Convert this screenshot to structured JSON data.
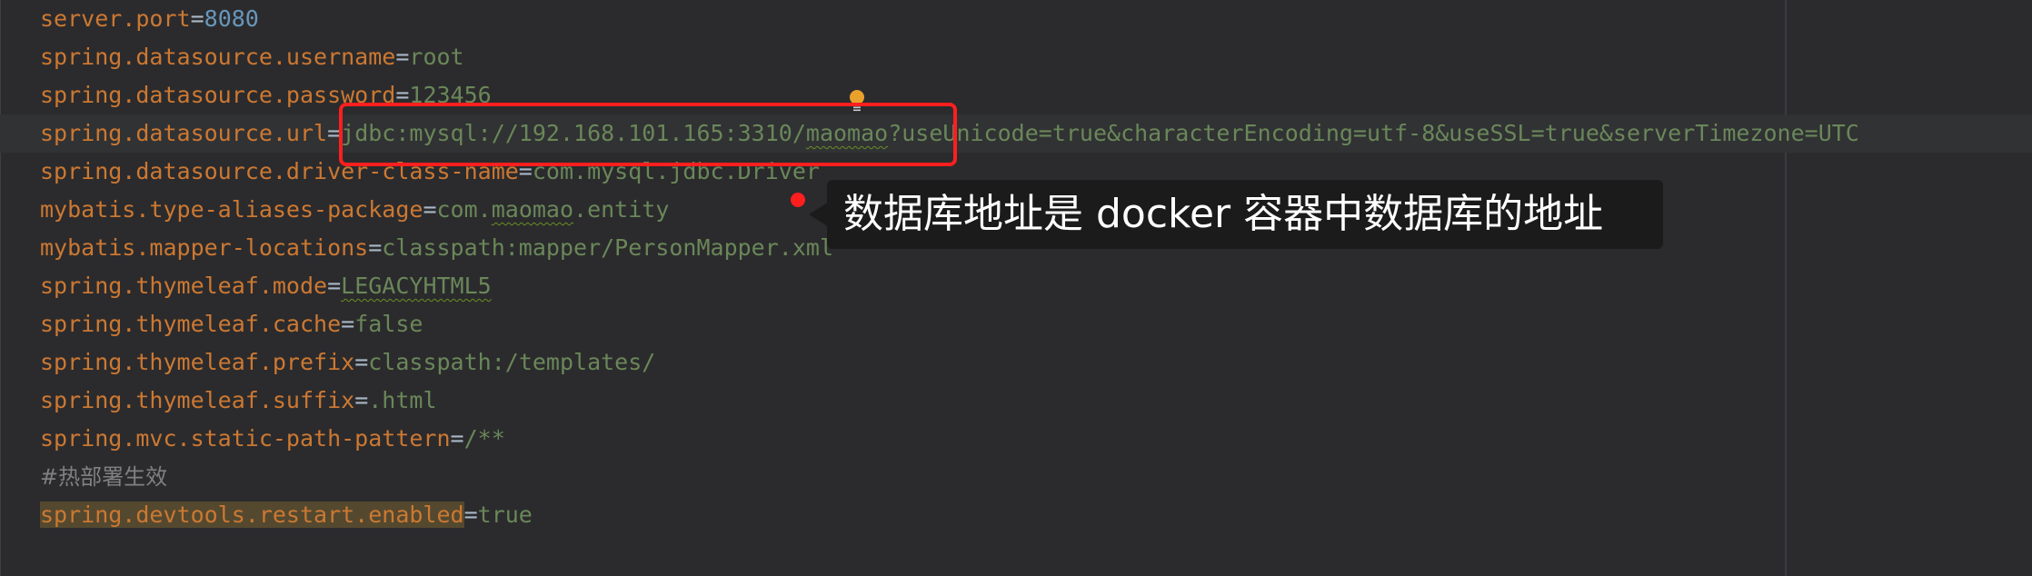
{
  "editor": {
    "lines": [
      {
        "key": "server.port",
        "eq": "=",
        "value": "8080",
        "value_kind": "number"
      },
      {
        "key": "spring.datasource.username",
        "eq": "=",
        "value": "root"
      },
      {
        "key": "spring.datasource.password",
        "eq": "=",
        "value": "123456"
      },
      {
        "key": "spring.datasource.url",
        "eq": "=",
        "value_a": "jdbc:mysql://192.168.101.165:3310/",
        "value_b": "maomao",
        "value_c": "?useUnicode=true&characterEncoding=utf-8&useSSL=true&serverTimezone=UTC"
      },
      {
        "key": "spring.datasource.driver-class-name",
        "eq": "=",
        "value": "com.mysql.jdbc.Driver"
      },
      {
        "key": "mybatis.type-aliases-package",
        "eq": "=",
        "value_a": "com.",
        "value_b": "maomao",
        "value_c": ".entity"
      },
      {
        "key": "mybatis.mapper-locations",
        "eq": "=",
        "value": "classpath:mapper/PersonMapper.xml"
      },
      {
        "key": "spring.thymeleaf.mode",
        "eq": "=",
        "value": "LEGACYHTML5"
      },
      {
        "key": "spring.thymeleaf.cache",
        "eq": "=",
        "value": "false"
      },
      {
        "key": "spring.thymeleaf.prefix",
        "eq": "=",
        "value": "classpath:/templates/"
      },
      {
        "key": "spring.thymeleaf.suffix",
        "eq": "=",
        "value": ".html"
      },
      {
        "key": "spring.mvc.static-path-pattern",
        "eq": "=",
        "value": "/**"
      },
      {
        "comment": "#热部署生效"
      },
      {
        "key": "spring.devtools.restart.enabled",
        "eq": "=",
        "value": "true"
      }
    ]
  },
  "annotation": {
    "text": "数据库地址是 docker 容器中数据库的地址"
  },
  "icons": {
    "bulb": "lightbulb-icon"
  },
  "colors": {
    "background": "#2b2b2d",
    "key": "#cc7832",
    "value": "#6a8759",
    "number": "#6897bb",
    "highlight_box": "#ff1f1f"
  }
}
